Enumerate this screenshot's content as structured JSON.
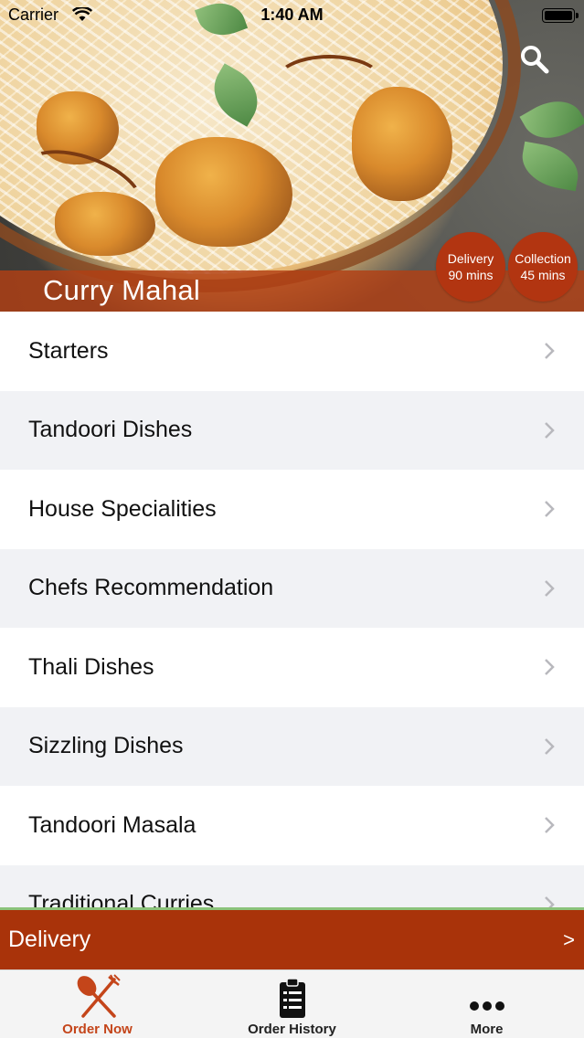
{
  "status_bar": {
    "carrier": "Carrier",
    "time": "1:40 AM"
  },
  "header": {
    "restaurant_name": "Curry Mahal",
    "delivery_badge": {
      "label": "Delivery",
      "time": "90 mins"
    },
    "collection_badge": {
      "label": "Collection",
      "time": "45 mins"
    },
    "search_icon": "search-icon"
  },
  "menu": {
    "categories": [
      {
        "label": "Starters"
      },
      {
        "label": "Tandoori Dishes"
      },
      {
        "label": "House Specialities"
      },
      {
        "label": "Chefs Recommendation"
      },
      {
        "label": "Thali Dishes"
      },
      {
        "label": "Sizzling Dishes"
      },
      {
        "label": "Tandoori Masala"
      },
      {
        "label": "Traditional Curries"
      }
    ]
  },
  "order_mode_bar": {
    "label": "Delivery",
    "arrow": ">"
  },
  "tabs": [
    {
      "label": "Order Now",
      "icon": "fork-knife-icon",
      "active": true
    },
    {
      "label": "Order History",
      "icon": "clipboard-icon",
      "active": false
    },
    {
      "label": "More",
      "icon": "more-dots-icon",
      "active": false
    }
  ],
  "colors": {
    "brand": "#a9330a",
    "badge": "#b23511",
    "active_tab": "#c4451a",
    "row_alt": "#f1f2f5",
    "accent_line": "#8bc37a"
  }
}
